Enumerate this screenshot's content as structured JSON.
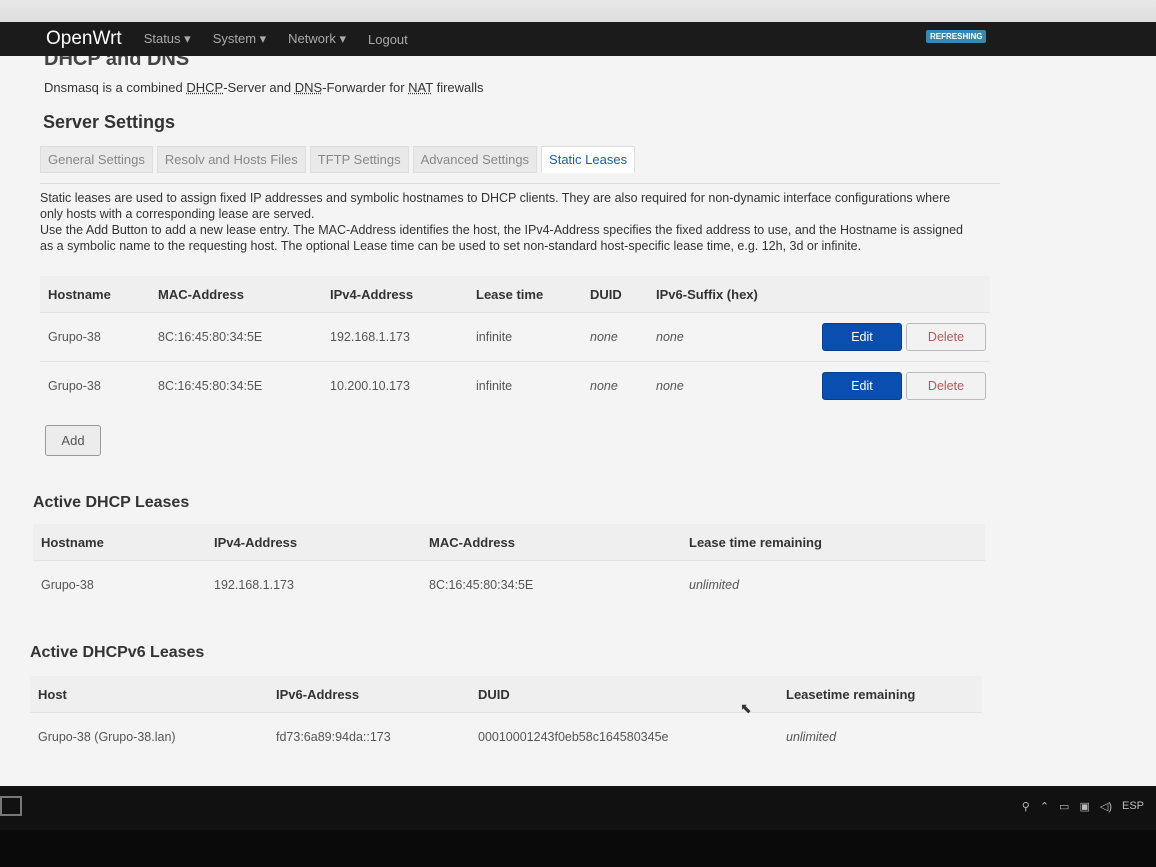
{
  "nav": {
    "brand": "OpenWrt",
    "items": [
      "Status ▾",
      "System ▾",
      "Network ▾",
      "Logout"
    ],
    "badge": "REFRESHING"
  },
  "page": {
    "section_title": "DHCP and DNS",
    "intro_parts": [
      "Dnsmasq is a combined ",
      "DHCP",
      "-Server and ",
      "DNS",
      "-Forwarder for ",
      "NAT",
      " firewalls"
    ],
    "server_settings_title": "Server Settings",
    "tabs": [
      "General Settings",
      "Resolv and Hosts Files",
      "TFTP Settings",
      "Advanced Settings",
      "Static Leases"
    ],
    "description_1": "Static leases are used to assign fixed IP addresses and symbolic hostnames to DHCP clients. They are also required for non-dynamic interface configurations where only hosts with a corresponding lease are served.",
    "description_2": "Use the Add Button to add a new lease entry. The MAC-Address identifies the host, the IPv4-Address specifies the fixed address to use, and the Hostname is assigned as a symbolic name to the requesting host. The optional Lease time can be used to set non-standard host-specific lease time, e.g. 12h, 3d or infinite."
  },
  "static_leases": {
    "headers": [
      "Hostname",
      "MAC-Address",
      "IPv4-Address",
      "Lease time",
      "DUID",
      "IPv6-Suffix (hex)"
    ],
    "rows": [
      {
        "hostname": "Grupo-38",
        "mac": "8C:16:45:80:34:5E",
        "ipv4": "192.168.1.173",
        "lease": "infinite",
        "duid": "none",
        "suffix": "none"
      },
      {
        "hostname": "Grupo-38",
        "mac": "8C:16:45:80:34:5E",
        "ipv4": "10.200.10.173",
        "lease": "infinite",
        "duid": "none",
        "suffix": "none"
      }
    ],
    "edit_label": "Edit",
    "delete_label": "Delete",
    "add_label": "Add"
  },
  "active_dhcp": {
    "title": "Active DHCP Leases",
    "headers": [
      "Hostname",
      "IPv4-Address",
      "MAC-Address",
      "Lease time remaining"
    ],
    "rows": [
      {
        "hostname": "Grupo-38",
        "ipv4": "192.168.1.173",
        "mac": "8C:16:45:80:34:5E",
        "remaining": "unlimited"
      }
    ]
  },
  "active_dhcpv6": {
    "title": "Active DHCPv6 Leases",
    "headers": [
      "Host",
      "IPv6-Address",
      "DUID",
      "Leasetime remaining"
    ],
    "rows": [
      {
        "host": "Grupo-38 (Grupo-38.lan)",
        "ipv6": "fd73:6a89:94da::173",
        "duid": "00010001243f0eb58c164580345e",
        "remaining": "unlimited"
      }
    ]
  },
  "taskbar": {
    "language": "ESP"
  }
}
